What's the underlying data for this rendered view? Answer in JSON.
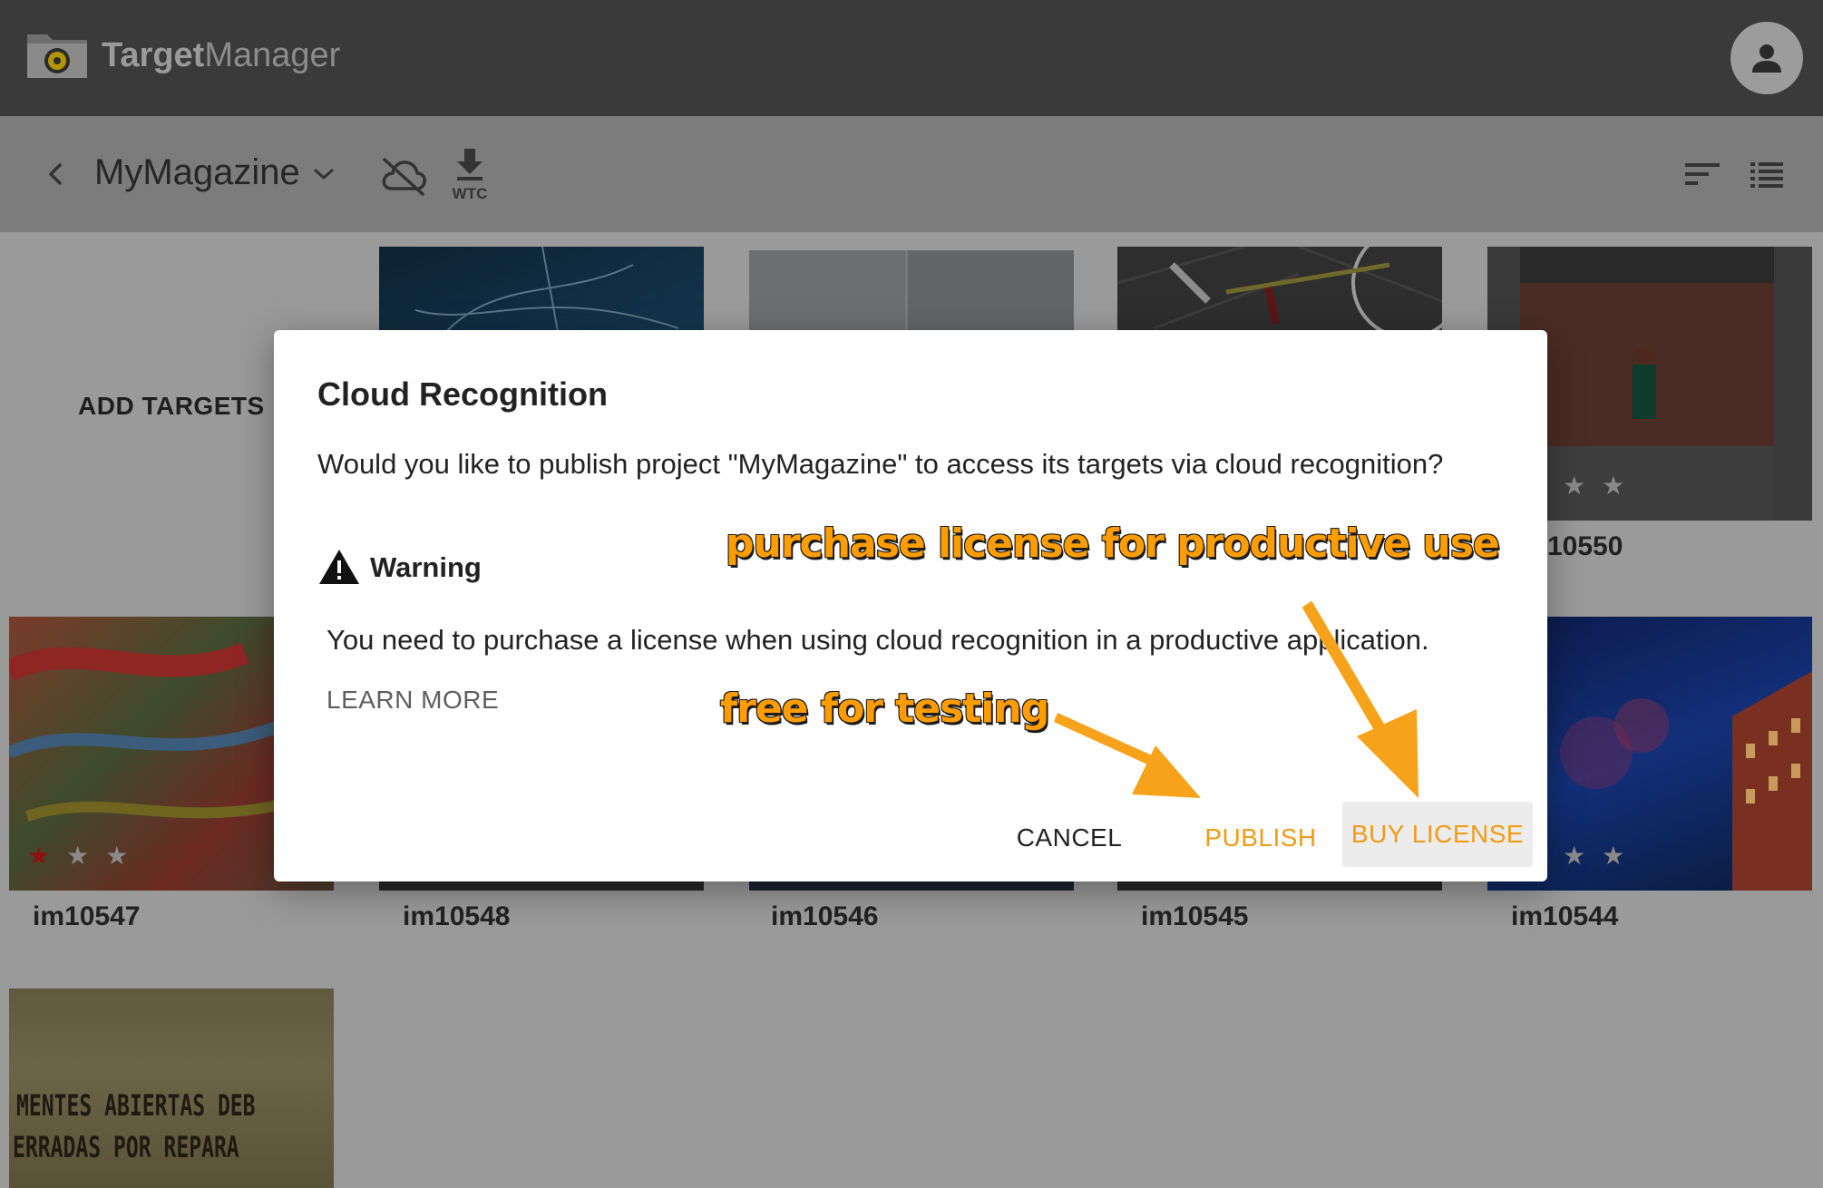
{
  "app": {
    "brand_bold": "Target",
    "brand_light": "Manager"
  },
  "toolbar": {
    "project_name": "MyMagazine",
    "wtc_label": "WTC"
  },
  "grid": {
    "add_targets_label": "ADD TARGETS",
    "tiles": [
      {
        "caption": "",
        "stars": 0
      },
      {
        "caption": "",
        "stars": 0
      },
      {
        "caption": "",
        "stars": 0
      },
      {
        "caption": "10550",
        "stars": 0
      },
      {
        "caption": "im10547",
        "stars": 1
      },
      {
        "caption": "im10548",
        "stars": 0
      },
      {
        "caption": "im10546",
        "stars": 0
      },
      {
        "caption": "im10545",
        "stars": 0
      },
      {
        "caption": "im10544",
        "stars": 0
      },
      {
        "caption": "",
        "stars": 0
      }
    ],
    "sign_line_1": "MENTES ABIERTAS DEB",
    "sign_line_2": "ERRADAS POR REPARA"
  },
  "dialog": {
    "title": "Cloud Recognition",
    "question": "Would you like to publish project \"MyMagazine\" to access its targets via cloud recognition?",
    "warning_title": "Warning",
    "warning_text": "You need to purchase a license when using cloud recognition in a productive application.",
    "learn_more": "LEARN MORE",
    "cancel_label": "CANCEL",
    "publish_label": "PUBLISH",
    "buy_label": "BUY LICENSE"
  },
  "annotations": {
    "purchase": "purchase license for productive use",
    "free": "free for testing"
  },
  "colors": {
    "accent": "#f29b16",
    "annotation": "#ff9d00",
    "appbar": "#3a3a3a",
    "toolbar": "#7c7c7c"
  }
}
